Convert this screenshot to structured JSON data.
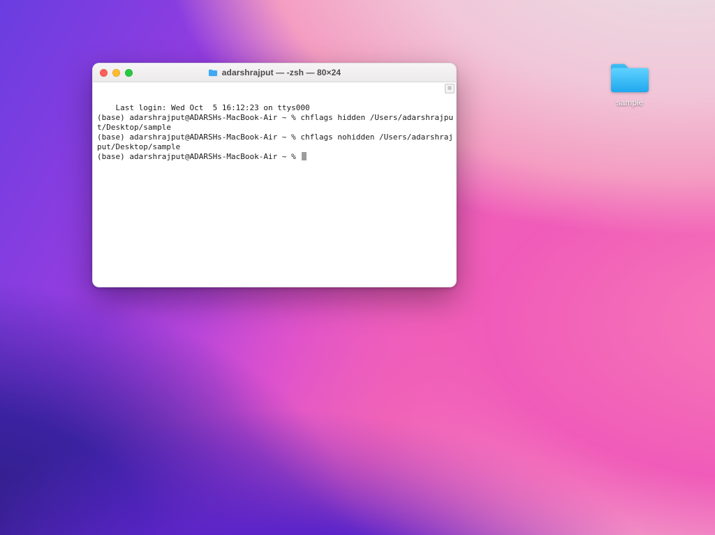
{
  "desktop": {
    "folder": {
      "label": "sample"
    }
  },
  "terminal": {
    "title": "adarshrajput — -zsh — 80×24",
    "lines": [
      "Last login: Wed Oct  5 16:12:23 on ttys000",
      "(base) adarshrajput@ADARSHs-MacBook-Air ~ % chflags hidden /Users/adarshrajput/Desktop/sample",
      "(base) adarshrajput@ADARSHs-MacBook-Air ~ % chflags nohidden /Users/adarshrajput/Desktop/sample",
      "(base) adarshrajput@ADARSHs-MacBook-Air ~ % "
    ]
  }
}
